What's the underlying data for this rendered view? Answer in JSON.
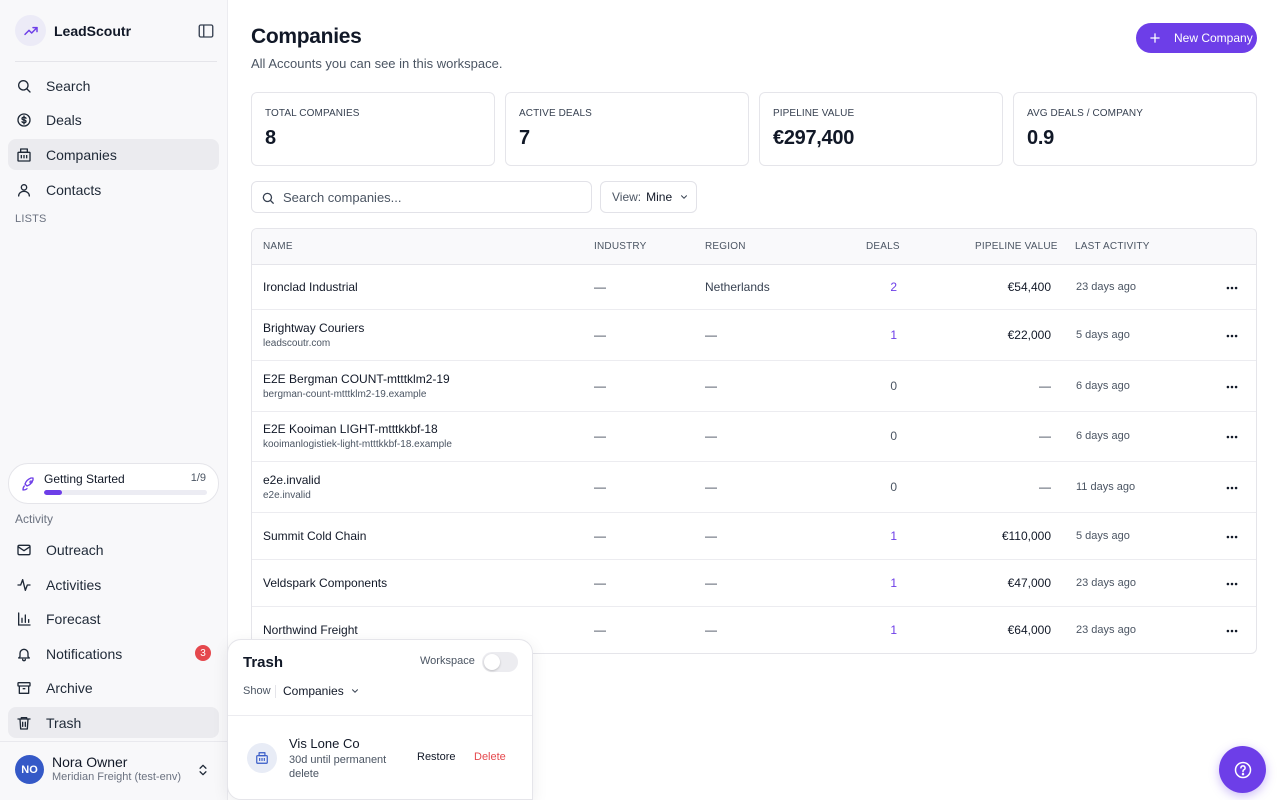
{
  "app": {
    "name": "LeadScoutr"
  },
  "nav": {
    "search": "Search",
    "deals": "Deals",
    "companies": "Companies",
    "contacts": "Contacts",
    "lists_heading": "LISTS",
    "activity_heading": "Activity",
    "outreach": "Outreach",
    "activities": "Activities",
    "forecast": "Forecast",
    "notifications": "Notifications",
    "notifications_count": "3",
    "archive": "Archive",
    "trash": "Trash"
  },
  "getting_started": {
    "title": "Getting Started",
    "progress_text": "1/9",
    "progress_fraction": 0.111
  },
  "user": {
    "initials": "NO",
    "name": "Nora Owner",
    "org": "Meridian Freight (test-env)"
  },
  "header": {
    "title": "Companies",
    "subtitle": "All Accounts you can see in this workspace.",
    "new_button": "New Company"
  },
  "stats": [
    {
      "label": "TOTAL COMPANIES",
      "value": "8"
    },
    {
      "label": "ACTIVE DEALS",
      "value": "7"
    },
    {
      "label": "PIPELINE VALUE",
      "value": "€297,400"
    },
    {
      "label": "AVG DEALS / COMPANY",
      "value": "0.9"
    }
  ],
  "search": {
    "placeholder": "Search companies..."
  },
  "view": {
    "label": "View:",
    "value": "Mine"
  },
  "table": {
    "columns": {
      "name": "NAME",
      "industry": "INDUSTRY",
      "region": "REGION",
      "deals": "DEALS",
      "pipeline": "PIPELINE VALUE",
      "activity": "LAST ACTIVITY"
    },
    "rows": [
      {
        "name": "Ironclad Industrial",
        "domain": "",
        "industry": "—",
        "region": "Netherlands",
        "deals": "2",
        "pipeline": "€54,400",
        "activity": "23 days ago"
      },
      {
        "name": "Brightway Couriers",
        "domain": "leadscoutr.com",
        "industry": "—",
        "region": "—",
        "deals": "1",
        "pipeline": "€22,000",
        "activity": "5 days ago"
      },
      {
        "name": "E2E Bergman COUNT-mtttklm2-19",
        "domain": "bergman-count-mtttklm2-19.example",
        "industry": "—",
        "region": "—",
        "deals": "0",
        "pipeline": "—",
        "activity": "6 days ago"
      },
      {
        "name": "E2E Kooiman LIGHT-mtttkkbf-18",
        "domain": "kooimanlogistiek-light-mtttkkbf-18.example",
        "industry": "—",
        "region": "—",
        "deals": "0",
        "pipeline": "—",
        "activity": "6 days ago"
      },
      {
        "name": "e2e.invalid",
        "domain": "e2e.invalid",
        "industry": "—",
        "region": "—",
        "deals": "0",
        "pipeline": "—",
        "activity": "11 days ago"
      },
      {
        "name": "Summit Cold Chain",
        "domain": "",
        "industry": "—",
        "region": "—",
        "deals": "1",
        "pipeline": "€110,000",
        "activity": "5 days ago"
      },
      {
        "name": "Veldspark Components",
        "domain": "",
        "industry": "—",
        "region": "—",
        "deals": "1",
        "pipeline": "€47,000",
        "activity": "23 days ago"
      },
      {
        "name": "Northwind Freight",
        "domain": "",
        "industry": "—",
        "region": "—",
        "deals": "1",
        "pipeline": "€64,000",
        "activity": "23 days ago"
      }
    ]
  },
  "trash_panel": {
    "title": "Trash",
    "workspace_label": "Workspace",
    "workspace_on": false,
    "show_label": "Show",
    "show_value": "Companies",
    "item": {
      "name": "Vis Lone Co",
      "meta": "30d until permanent delete",
      "restore": "Restore",
      "delete": "Delete"
    }
  },
  "colors": {
    "accent": "#6d3ee8",
    "danger": "#e5484d",
    "avatar": "#3559c7"
  }
}
